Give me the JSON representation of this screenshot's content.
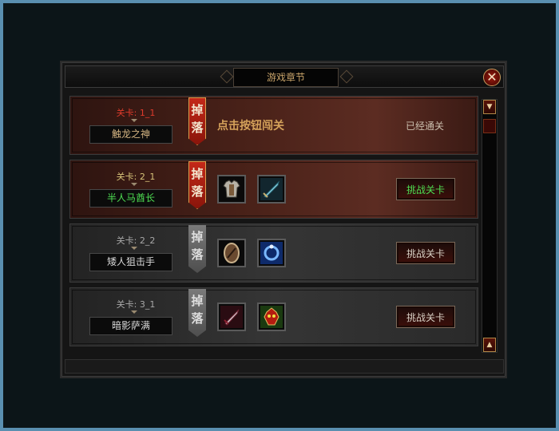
{
  "window": {
    "title": "游戏章节",
    "close_label": "✕"
  },
  "drop_label": "掉落",
  "stages": [
    {
      "stage": "关卡: 1_1",
      "name": "触龙之神",
      "state": "cleared",
      "hint": "点击按钮闯关",
      "status": "已经通关",
      "items": []
    },
    {
      "stage": "关卡: 2_1",
      "name": "半人马酋长",
      "state": "available",
      "button": "挑战关卡",
      "items": [
        "armor-icon",
        "sword-icon"
      ]
    },
    {
      "stage": "关卡: 2_2",
      "name": "矮人狙击手",
      "state": "locked",
      "button": "挑战关卡",
      "items": [
        "shield-icon",
        "ring-icon"
      ]
    },
    {
      "stage": "关卡: 3_1",
      "name": "暗影萨满",
      "state": "locked",
      "button": "挑战关卡",
      "items": [
        "dagger-icon",
        "demon-mask-icon"
      ]
    }
  ],
  "scroll": {
    "up": "▲",
    "down": "▼"
  },
  "colors": {
    "accent_gold": "#d4a15a",
    "active_green": "#4ede52",
    "stage_red": "#e03b2c"
  }
}
